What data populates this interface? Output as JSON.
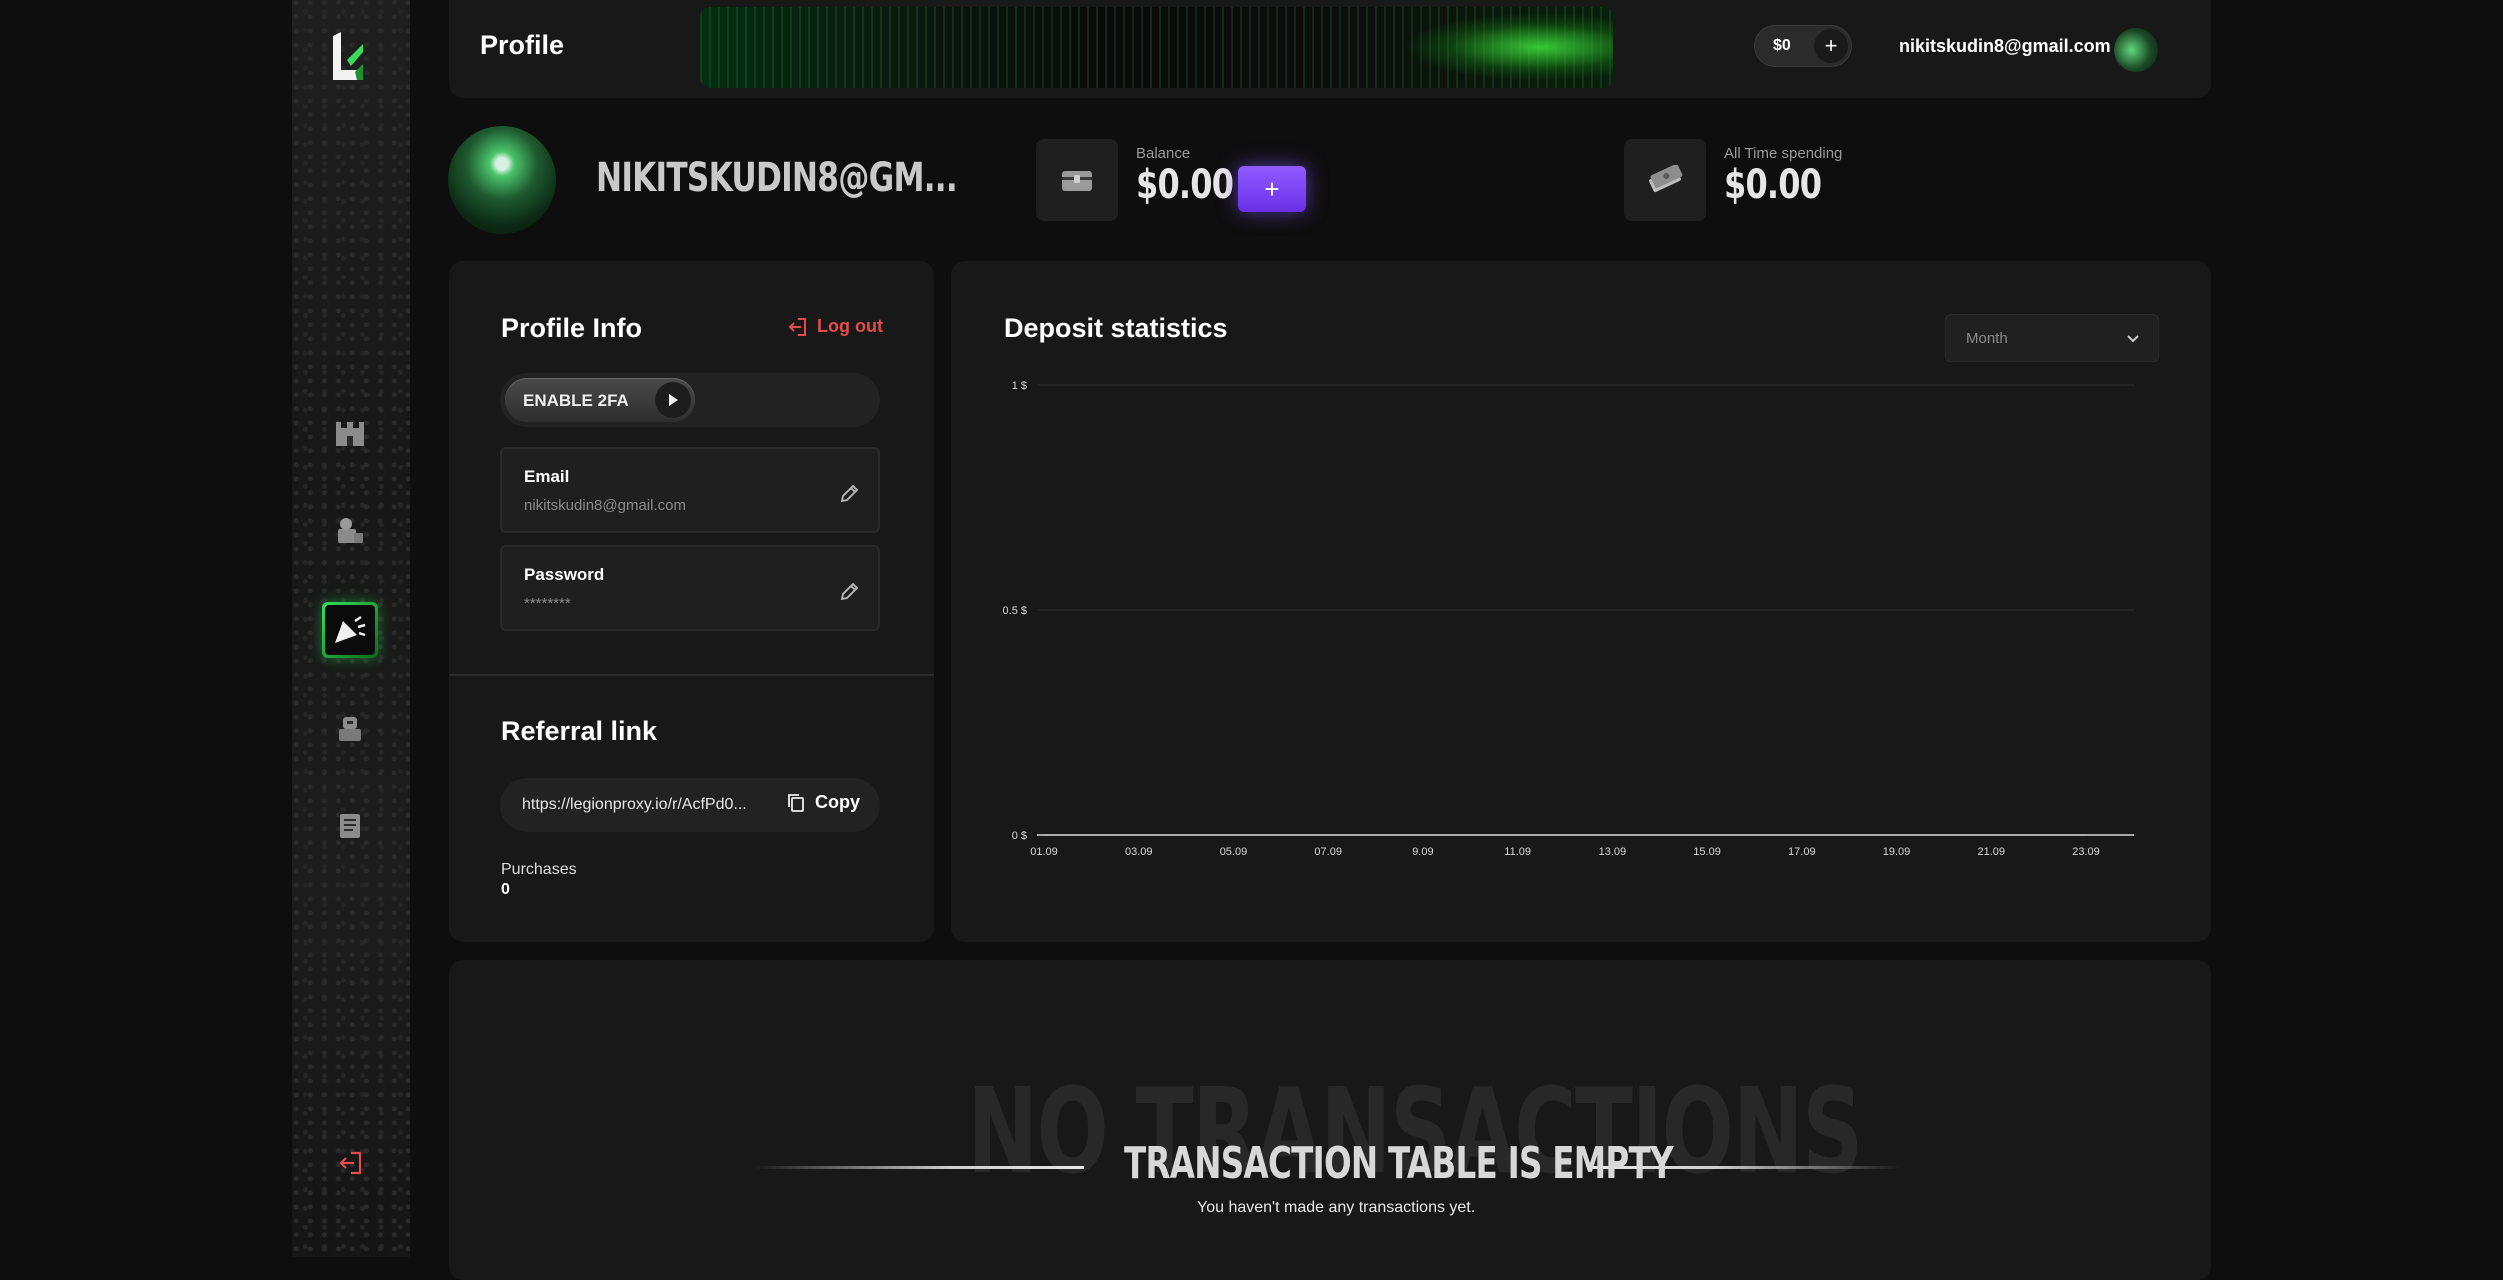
{
  "header": {
    "title": "Profile",
    "wallet_balance": "$0",
    "wallet_add": "+",
    "user_email": "nikitskudin8@gmail.com"
  },
  "sidebar": {
    "items": [
      {
        "name": "castle-icon"
      },
      {
        "name": "shop-icon"
      },
      {
        "name": "megaphone-icon",
        "active": true
      },
      {
        "name": "knight-icon"
      },
      {
        "name": "scroll-icon"
      }
    ],
    "logout_icon": "logout-icon"
  },
  "summary": {
    "display_name": "NIKITSKUDIN8@GM...",
    "balance_label": "Balance",
    "balance_value": "$0.00",
    "topup_label": "+",
    "spending_label": "All Time spending",
    "spending_value": "$0.00"
  },
  "profile_info": {
    "title": "Profile Info",
    "logout_label": "Log out",
    "twofa_label": "ENABLE 2FA",
    "email_label": "Email",
    "email_value": "nikitskudin8@gmail.com",
    "password_label": "Password",
    "password_value": "********"
  },
  "referral": {
    "title": "Referral link",
    "link": "https://legionproxy.io/r/AcfPd0...",
    "copy_label": "Copy",
    "purchases_label": "Purchases",
    "purchases_value": "0"
  },
  "deposit": {
    "title": "Deposit statistics",
    "period": "Month"
  },
  "chart_data": {
    "type": "line",
    "title": "Deposit statistics",
    "x": [
      "01.09",
      "03.09",
      "05.09",
      "07.09",
      "9.09",
      "11.09",
      "13.09",
      "15.09",
      "17.09",
      "19.09",
      "21.09",
      "23.09"
    ],
    "y_ticks": [
      "1 $",
      "0.5 $",
      "0 $"
    ],
    "ylim": [
      0,
      1
    ],
    "series": [
      {
        "values": [
          0,
          0,
          0,
          0,
          0,
          0,
          0,
          0,
          0,
          0,
          0,
          0
        ]
      }
    ],
    "grid": true
  },
  "transactions": {
    "bg_text": "NO TRANSACTIONS",
    "title": "TRANSACTION TABLE IS EMPTY",
    "subtitle": "You haven't made any transactions yet."
  },
  "colors": {
    "accent_green": "#37e05a",
    "accent_purple": "#7b45f5",
    "logout_red": "#e24c4c"
  }
}
